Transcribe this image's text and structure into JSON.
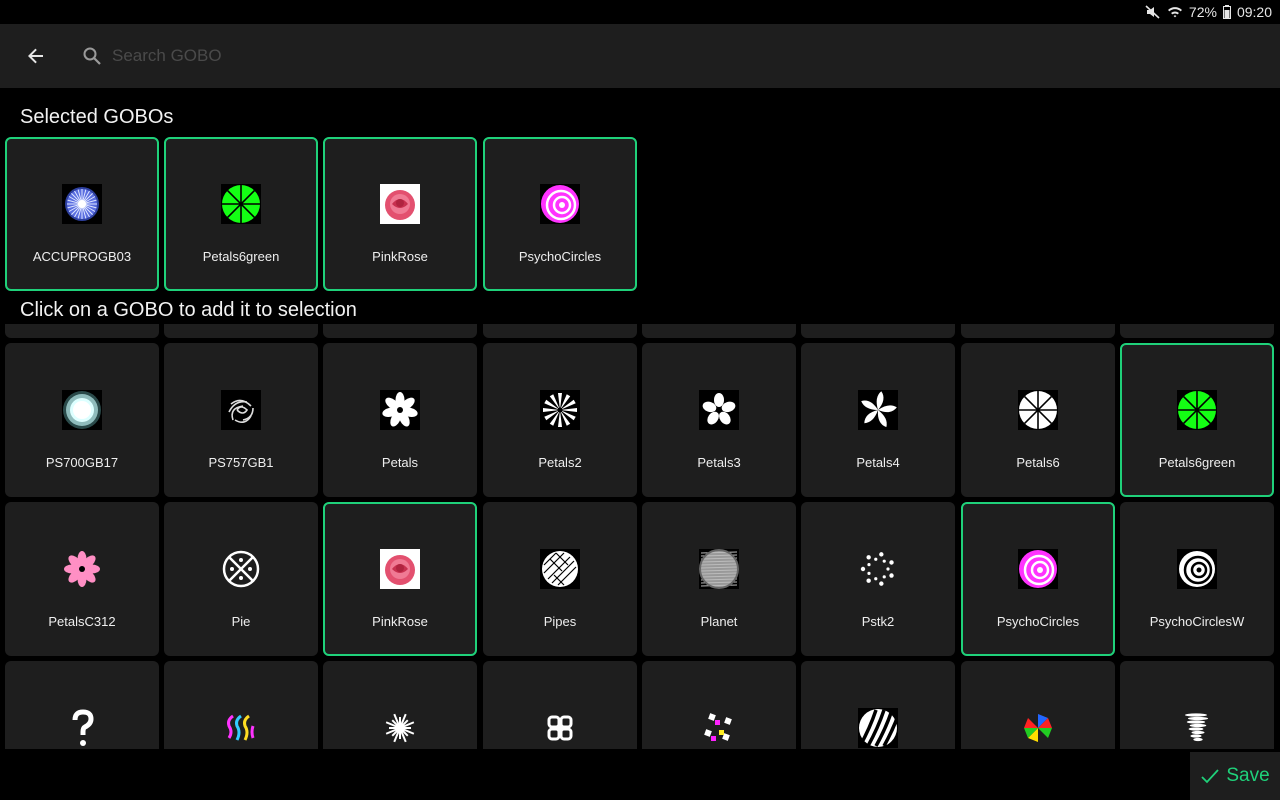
{
  "status": {
    "battery": "72%",
    "time": "09:20"
  },
  "search": {
    "placeholder": "Search GOBO"
  },
  "selected_title": "Selected GOBOs",
  "library_title": "Click on a GOBO to add it to selection",
  "selected": [
    {
      "label": "ACCUPROGB03",
      "icon": "accuprogb03-gobo-icon"
    },
    {
      "label": "Petals6green",
      "icon": "petals6green-gobo-icon"
    },
    {
      "label": "PinkRose",
      "icon": "pinkrose-gobo-icon"
    },
    {
      "label": "PsychoCircles",
      "icon": "psychocircles-gobo-icon"
    }
  ],
  "library": [
    {
      "label": "PS700GB17",
      "icon": "ps700gb17-gobo-icon",
      "selected": false
    },
    {
      "label": "PS757GB1",
      "icon": "ps757gb1-gobo-icon",
      "selected": false
    },
    {
      "label": "Petals",
      "icon": "petals-gobo-icon",
      "selected": false
    },
    {
      "label": "Petals2",
      "icon": "petals2-gobo-icon",
      "selected": false
    },
    {
      "label": "Petals3",
      "icon": "petals3-gobo-icon",
      "selected": false
    },
    {
      "label": "Petals4",
      "icon": "petals4-gobo-icon",
      "selected": false
    },
    {
      "label": "Petals6",
      "icon": "petals6-gobo-icon",
      "selected": false
    },
    {
      "label": "Petals6green",
      "icon": "petals6green-gobo-icon",
      "selected": true
    },
    {
      "label": "PetalsC312",
      "icon": "petalsc312-gobo-icon",
      "selected": false
    },
    {
      "label": "Pie",
      "icon": "pie-gobo-icon",
      "selected": false
    },
    {
      "label": "PinkRose",
      "icon": "pinkrose-gobo-icon",
      "selected": true
    },
    {
      "label": "Pipes",
      "icon": "pipes-gobo-icon",
      "selected": false
    },
    {
      "label": "Planet",
      "icon": "planet-gobo-icon",
      "selected": false
    },
    {
      "label": "Pstk2",
      "icon": "pstk2-gobo-icon",
      "selected": false
    },
    {
      "label": "PsychoCircles",
      "icon": "psychocircles-gobo-icon",
      "selected": true
    },
    {
      "label": "PsychoCirclesW",
      "icon": "psychocirclesw-gobo-icon",
      "selected": false
    },
    {
      "label": "",
      "icon": "question-gobo-icon",
      "selected": false
    },
    {
      "label": "",
      "icon": "wavy-lines-gobo-icon",
      "selected": false
    },
    {
      "label": "",
      "icon": "starburst-gobo-icon",
      "selected": false
    },
    {
      "label": "",
      "icon": "knot-gobo-icon",
      "selected": false
    },
    {
      "label": "",
      "icon": "magenta-squares-gobo-icon",
      "selected": false
    },
    {
      "label": "",
      "icon": "sphere-lines-gobo-icon",
      "selected": false
    },
    {
      "label": "",
      "icon": "color-windmill-gobo-icon",
      "selected": false
    },
    {
      "label": "",
      "icon": "tornado-gobo-icon",
      "selected": false
    }
  ],
  "save_label": "Save",
  "colors": {
    "accent": "#1fd17a",
    "tile": "#1e1e1e",
    "appbar": "#1e1e1e"
  }
}
